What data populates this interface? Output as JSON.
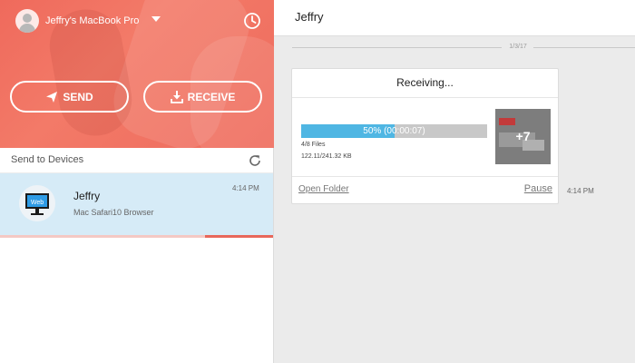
{
  "account": {
    "name": "Jeffry's MacBook Pro"
  },
  "buttons": {
    "send": "SEND",
    "receive": "RECEIVE"
  },
  "devices": {
    "label": "Send to Devices",
    "items": [
      {
        "badge": "Web",
        "name": "Jeffry",
        "description": "Mac Safari10 Browser",
        "time": "4:14 PM",
        "progress": 0.25
      }
    ]
  },
  "chat": {
    "title": "Jeffry",
    "date": "1/3/17",
    "transfer": {
      "status": "Receiving...",
      "progress_percent": 50,
      "progress_label": "50% (00:00:07)",
      "files": "4/8 Files",
      "size": "122.11/241.32 KB",
      "thumbnail_more": "+7",
      "open_folder": "Open Folder",
      "pause": "Pause",
      "time": "4:14 PM"
    }
  },
  "colors": {
    "brand": "#ef6a5c",
    "selected_device": "#d6ebf7",
    "progress": "#4fb6e3"
  },
  "icons": {
    "avatar": "user-avatar",
    "account_menu": "chevron-down-icon",
    "history": "clock-icon",
    "send": "paper-plane-icon",
    "receive": "download-icon",
    "refresh": "refresh-icon",
    "device": "monitor-icon"
  }
}
